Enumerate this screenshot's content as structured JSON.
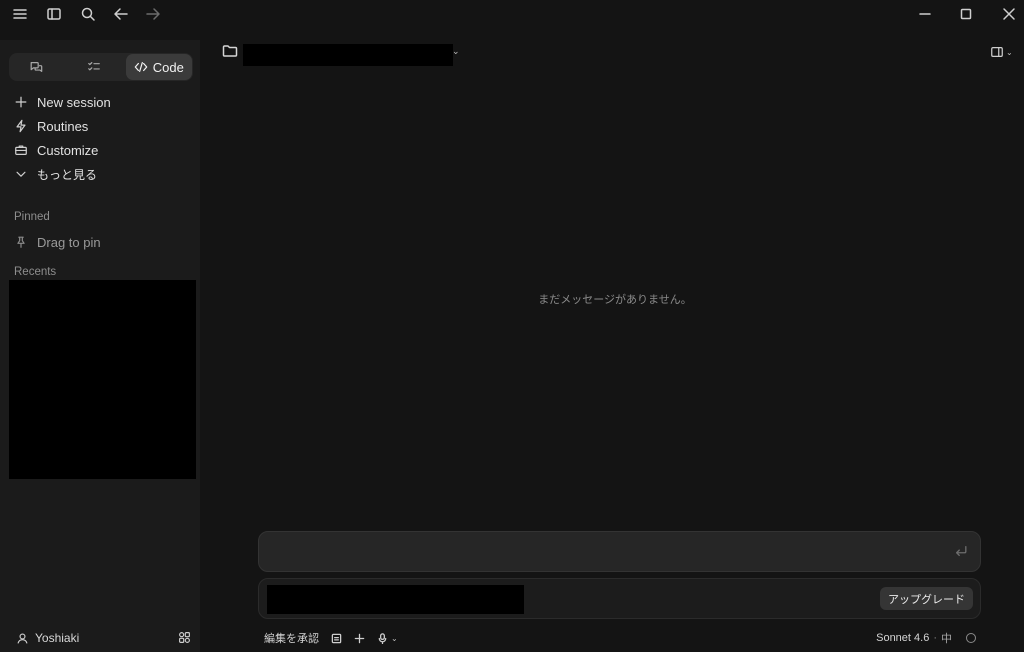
{
  "sidebar": {
    "modes": [
      {
        "label": "",
        "icon": "chat-bubbles-icon"
      },
      {
        "label": "",
        "icon": "checklist-icon"
      },
      {
        "label": "Code",
        "icon": "code-icon",
        "active": true
      }
    ],
    "nav": [
      {
        "label": "New session",
        "icon": "plus-icon"
      },
      {
        "label": "Routines",
        "icon": "lightning-icon"
      },
      {
        "label": "Customize",
        "icon": "briefcase-icon"
      },
      {
        "label": "もっと見る",
        "icon": "chevron-down-icon"
      }
    ],
    "pinned_label": "Pinned",
    "pinned_hint": "Drag to pin",
    "recents_label": "Recents",
    "user_name": "Yoshiaki"
  },
  "main": {
    "empty_message": "まだメッセージがありません。"
  },
  "composer": {
    "upgrade_label": "アップグレード"
  },
  "footer": {
    "accept_edits_label": "編集を承認",
    "model_name": "Sonnet 4.6",
    "separator": "·",
    "effort_label": "中"
  }
}
